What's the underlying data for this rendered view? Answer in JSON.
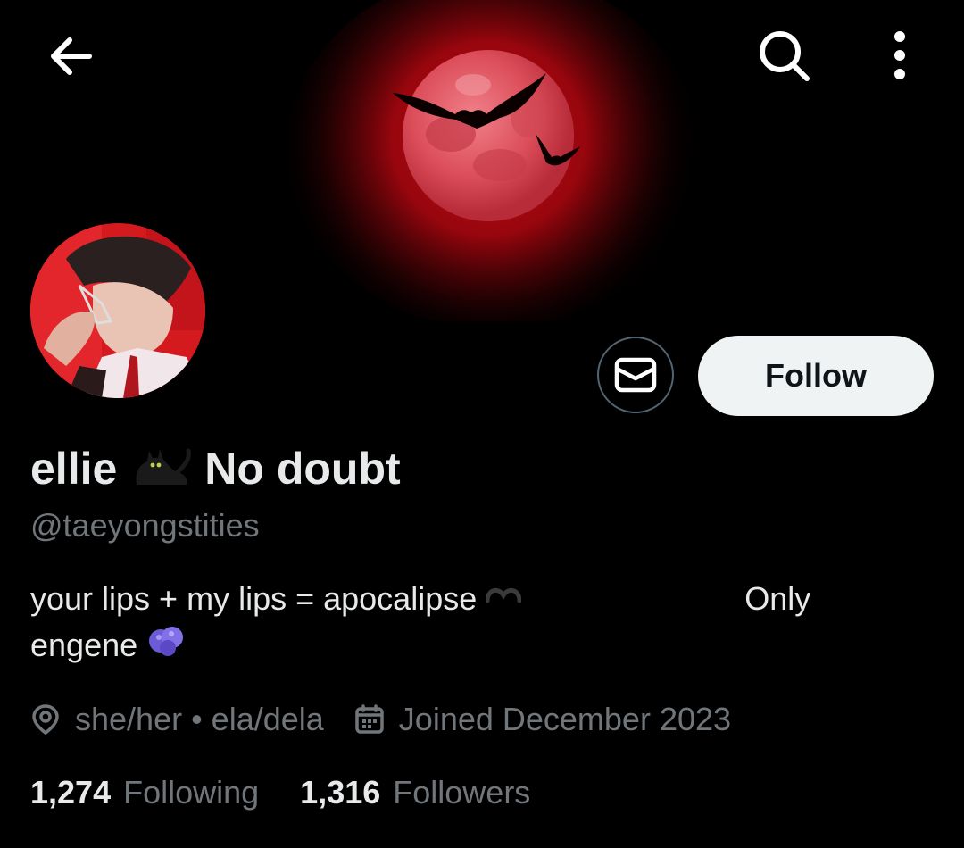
{
  "profile": {
    "display_name_start": "ellie",
    "display_name_end": "No doubt",
    "handle": "@taeyongstities",
    "bio_line1_start": "your lips + my lips = apocalipse",
    "bio_line1_end": "Only",
    "bio_line2": "engene",
    "location": "she/her • ela/dela",
    "joined": "Joined December 2023",
    "following_count": "1,274",
    "following_label": "Following",
    "followers_count": "1,316",
    "followers_label": "Followers"
  },
  "actions": {
    "follow_label": "Follow"
  },
  "icons": {
    "back": "back-arrow-icon",
    "search": "search-icon",
    "more": "more-vertical-icon",
    "message": "mail-icon",
    "location": "location-pin-icon",
    "calendar": "calendar-icon",
    "name_emoji": "black-cat-emoji",
    "bio_emoji_1": "heart-emoji",
    "bio_emoji_2": "blueberries-emoji"
  },
  "colors": {
    "background": "#000000",
    "primary_text": "#e7e9ea",
    "secondary_text": "#71767b",
    "follow_button_bg": "#eff3f4",
    "moon_red": "#d94b55"
  }
}
